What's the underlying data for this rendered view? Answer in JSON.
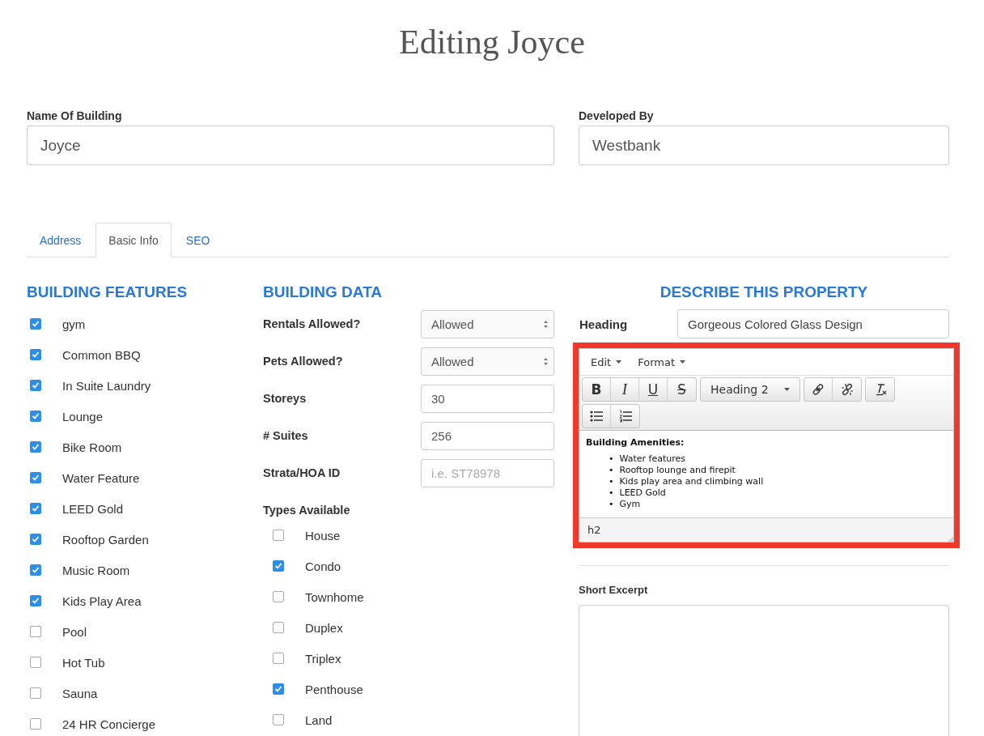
{
  "page_title": "Editing Joyce",
  "name_field": {
    "label": "Name Of Building",
    "value": "Joyce"
  },
  "developer_field": {
    "label": "Developed By",
    "value": "Westbank"
  },
  "tabs": [
    {
      "label": "Address",
      "selected": false
    },
    {
      "label": "Basic Info",
      "selected": true
    },
    {
      "label": "SEO",
      "selected": false
    }
  ],
  "features": {
    "title": "BUILDING FEATURES",
    "items": [
      {
        "label": "gym",
        "checked": true
      },
      {
        "label": "Common BBQ",
        "checked": true
      },
      {
        "label": "In Suite Laundry",
        "checked": true
      },
      {
        "label": "Lounge",
        "checked": true
      },
      {
        "label": "Bike Room",
        "checked": true
      },
      {
        "label": "Water Feature",
        "checked": true
      },
      {
        "label": "LEED Gold",
        "checked": true
      },
      {
        "label": "Rooftop Garden",
        "checked": true
      },
      {
        "label": "Music Room",
        "checked": true
      },
      {
        "label": "Kids Play Area",
        "checked": true
      },
      {
        "label": "Pool",
        "checked": false
      },
      {
        "label": "Hot Tub",
        "checked": false
      },
      {
        "label": "Sauna",
        "checked": false
      },
      {
        "label": "24 HR Concierge",
        "checked": false
      }
    ]
  },
  "building_data": {
    "title": "BUILDING DATA",
    "fields": [
      {
        "kind": "select",
        "label": "Rentals Allowed?",
        "value": "Allowed"
      },
      {
        "kind": "select",
        "label": "Pets Allowed?",
        "value": "Allowed"
      },
      {
        "kind": "text",
        "label": "Storeys",
        "value": "30"
      },
      {
        "kind": "text",
        "label": "# Suites",
        "value": "256"
      },
      {
        "kind": "text",
        "label": "Strata/HOA ID",
        "placeholder": "i.e. ST78978"
      }
    ],
    "types_label": "Types Available",
    "types": [
      {
        "label": "House",
        "checked": false
      },
      {
        "label": "Condo",
        "checked": true
      },
      {
        "label": "Townhome",
        "checked": false
      },
      {
        "label": "Duplex",
        "checked": false
      },
      {
        "label": "Triplex",
        "checked": false
      },
      {
        "label": "Penthouse",
        "checked": true
      },
      {
        "label": "Land",
        "checked": false
      }
    ]
  },
  "describe": {
    "title": "DESCRIBE THIS PROPERTY",
    "heading_label": "Heading",
    "heading_value": "Gorgeous Colored Glass Design",
    "editor": {
      "highlighted": true,
      "menus": [
        "Edit",
        "Format"
      ],
      "toolbar": [
        {
          "kind": "bold",
          "label": "B"
        },
        {
          "kind": "italic",
          "label": "I"
        },
        {
          "kind": "underline",
          "label": "U"
        },
        {
          "kind": "strike",
          "label": "S"
        },
        {
          "kind": "format",
          "label": "Heading 2"
        },
        {
          "kind": "link"
        },
        {
          "kind": "unlink"
        },
        {
          "kind": "clear"
        },
        {
          "kind": "bullets"
        },
        {
          "kind": "numbers"
        }
      ],
      "content_heading": "Building Amenities:",
      "bullet": "•",
      "content_items": [
        "Water features",
        "Rooftop lounge and firepit",
        "Kids play area and climbing wall",
        "LEED Gold",
        "Gym"
      ],
      "status_path": "h2"
    },
    "excerpt_label": "Short Excerpt"
  }
}
